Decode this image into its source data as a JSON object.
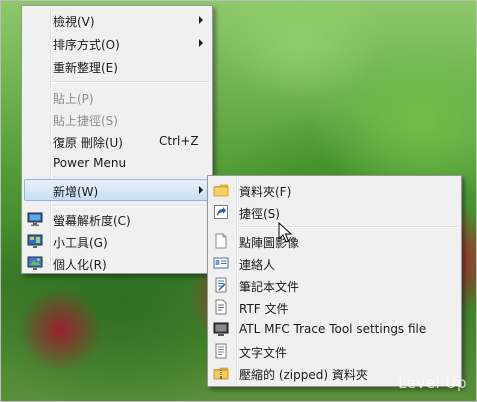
{
  "context_menu": {
    "items": [
      {
        "label": "檢視(V)",
        "has_submenu": true
      },
      {
        "label": "排序方式(O)",
        "has_submenu": true
      },
      {
        "label": "重新整理(E)"
      },
      {
        "label": "貼上(P)",
        "disabled": true
      },
      {
        "label": "貼上捷徑(S)",
        "disabled": true
      },
      {
        "label": "復原 刪除(U)",
        "shortcut": "Ctrl+Z"
      },
      {
        "label": "Power Menu"
      },
      {
        "label": "新增(W)",
        "has_submenu": true,
        "highlighted": true
      },
      {
        "label": "螢幕解析度(C)",
        "icon": "display-icon"
      },
      {
        "label": "小工具(G)",
        "icon": "gadgets-icon"
      },
      {
        "label": "個人化(R)",
        "icon": "personalize-icon"
      }
    ]
  },
  "new_submenu": {
    "items": [
      {
        "label": "資料夾(F)",
        "icon": "folder-icon"
      },
      {
        "label": "捷徑(S)",
        "icon": "shortcut-icon"
      },
      {
        "label": "點陣圖影像",
        "icon": "bitmap-file-icon"
      },
      {
        "label": "連絡人",
        "icon": "contact-card-icon"
      },
      {
        "label": "筆記本文件",
        "icon": "journal-document-icon"
      },
      {
        "label": "RTF 文件",
        "icon": "rtf-document-icon"
      },
      {
        "label": "ATL MFC Trace Tool settings file",
        "icon": "trace-tool-icon"
      },
      {
        "label": "文字文件",
        "icon": "text-document-icon"
      },
      {
        "label": "壓縮的 (zipped) 資料夾",
        "icon": "zip-folder-icon"
      }
    ]
  },
  "watermark": "Level Up",
  "colors": {
    "highlight": "#c9def5",
    "highlight_border": "#8eb5e6",
    "disabled_text": "#8d8d8d",
    "menu_bg": "#f0f0f0"
  }
}
